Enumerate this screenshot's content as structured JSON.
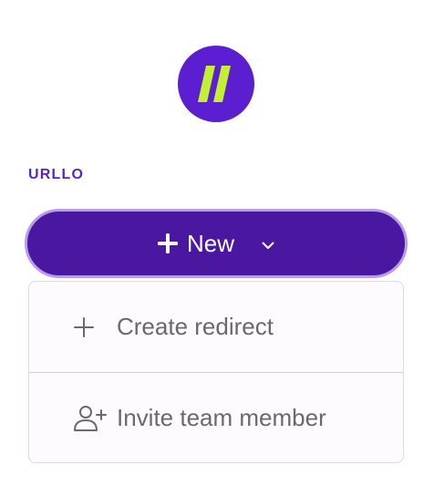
{
  "workspace": {
    "name": "URLLO"
  },
  "new_button": {
    "label": "New"
  },
  "menu": {
    "items": [
      {
        "label": "Create redirect",
        "icon": "plus-icon"
      },
      {
        "label": "Invite team member",
        "icon": "user-plus-icon"
      }
    ]
  },
  "colors": {
    "brand": "#5b1fd1",
    "accent_logo": "#c4f032",
    "button_bg": "#4a18a0",
    "button_border": "#b79cf0"
  }
}
